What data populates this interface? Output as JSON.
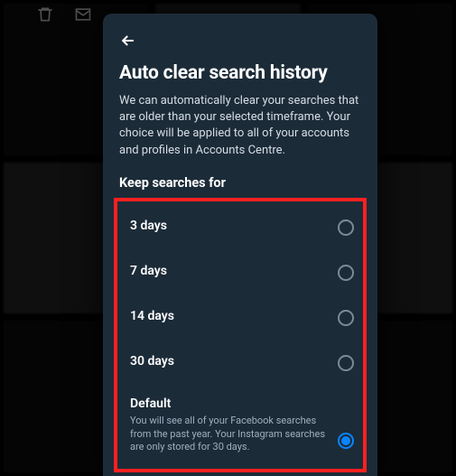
{
  "header": {
    "title": "Auto clear search history",
    "description": "We can automatically clear your searches that are older than your selected timeframe. Your choice will be applied to all of your accounts and profiles in Accounts Centre.",
    "subheading": "Keep searches for"
  },
  "options": [
    {
      "label": "3 days",
      "desc": "",
      "selected": false
    },
    {
      "label": "7 days",
      "desc": "",
      "selected": false
    },
    {
      "label": "14 days",
      "desc": "",
      "selected": false
    },
    {
      "label": "30 days",
      "desc": "",
      "selected": false
    },
    {
      "label": "Default",
      "desc": "You will see all of your Facebook searches from the past year. Your Instagram searches are only stored for 30 days.",
      "selected": true
    }
  ]
}
